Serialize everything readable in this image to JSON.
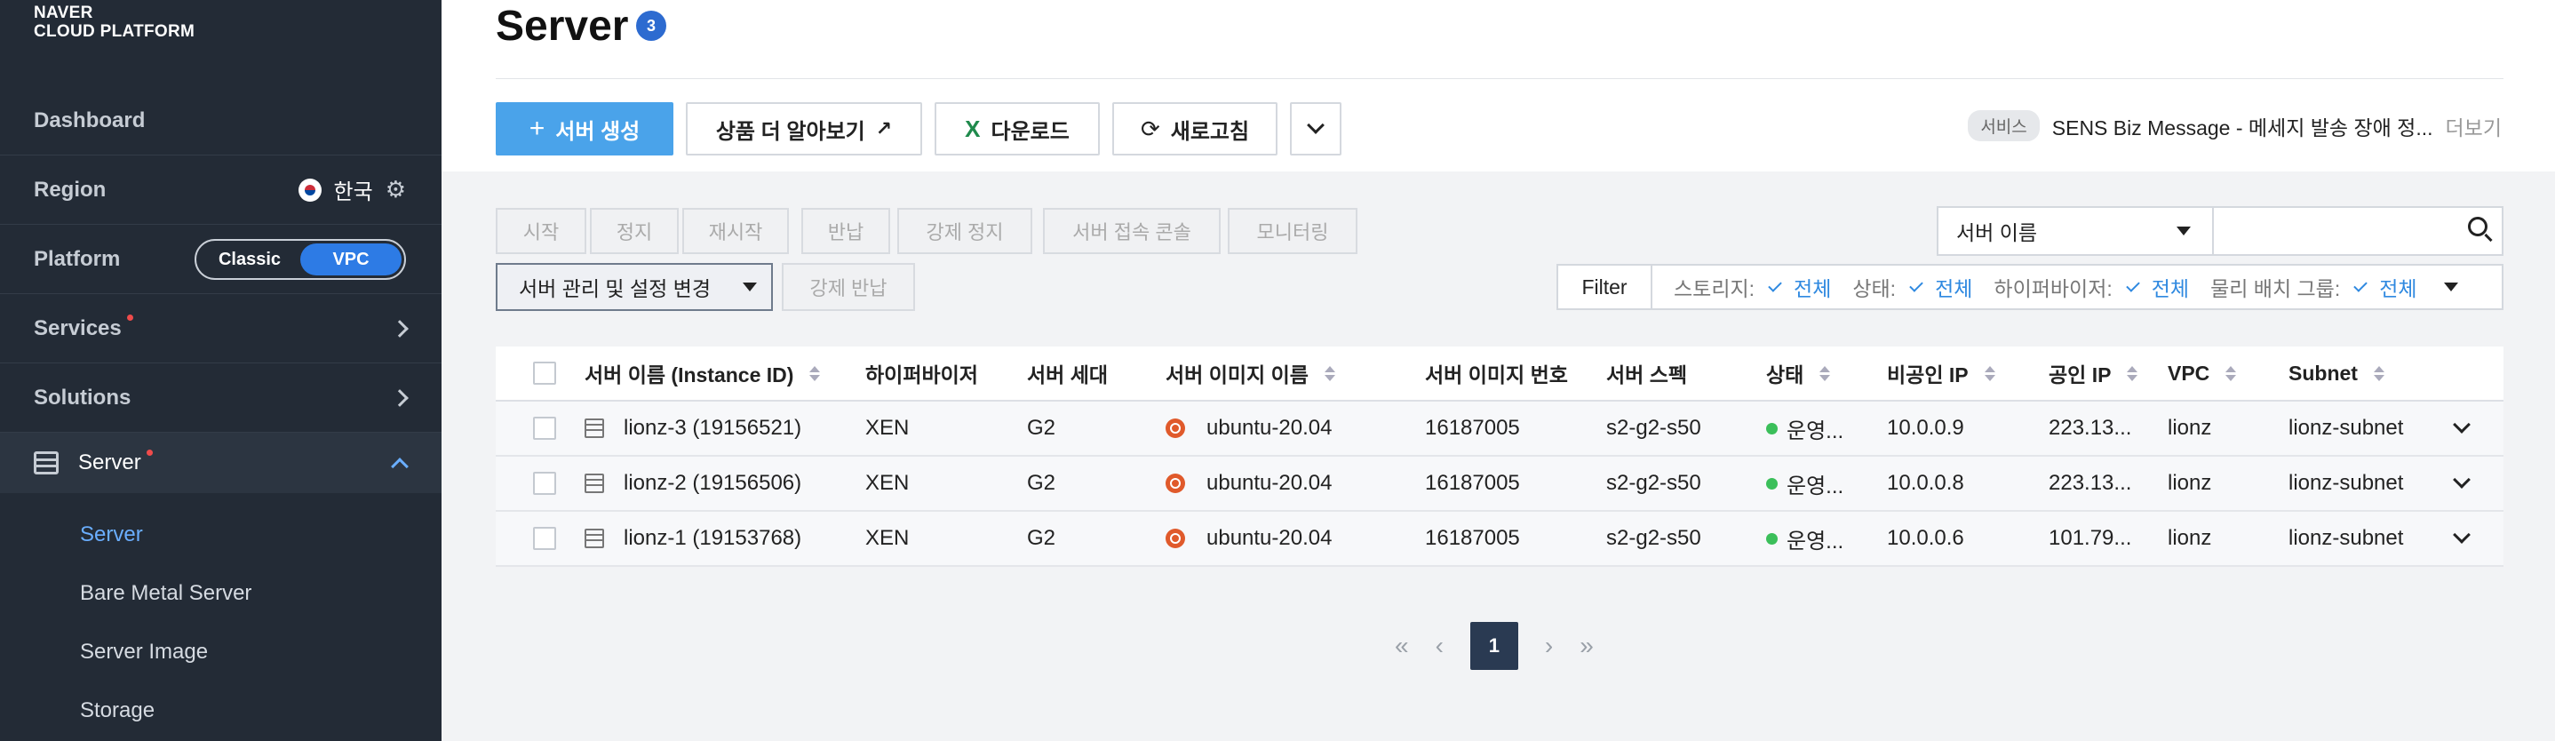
{
  "logo": {
    "line1": "NAVER",
    "line2": "CLOUD PLATFORM"
  },
  "sidebar": {
    "dashboard": "Dashboard",
    "region_label": "Region",
    "region_value": "한국",
    "platform_label": "Platform",
    "platform_options": [
      "Classic",
      "VPC"
    ],
    "platform_selected": "VPC",
    "services": "Services",
    "solutions": "Solutions",
    "server": "Server",
    "sub_items": [
      "Server",
      "Bare Metal Server",
      "Server Image",
      "Storage"
    ],
    "active_sub": "Server"
  },
  "header": {
    "title": "Server",
    "count": "3"
  },
  "toolbar": {
    "create": "서버 생성",
    "learn_more": "상품 더 알아보기",
    "download": "다운로드",
    "refresh": "새로고침"
  },
  "notice": {
    "tag": "서비스",
    "text": "SENS Biz Message - 메세지 발송 장애 정...",
    "more": "더보기"
  },
  "actions": [
    "시작",
    "정지",
    "재시작",
    "반납",
    "강제 정지",
    "서버 접속 콘솔",
    "모니터링"
  ],
  "manage": {
    "label": "서버 관리 및 설정 변경",
    "force_return": "강제 반납"
  },
  "search": {
    "field": "서버 이름",
    "value": ""
  },
  "filter": {
    "label": "Filter",
    "items": [
      {
        "name": "스토리지:",
        "value": "전체"
      },
      {
        "name": "상태:",
        "value": "전체"
      },
      {
        "name": "하이퍼바이저:",
        "value": "전체"
      },
      {
        "name": "물리 배치 그룹:",
        "value": "전체"
      }
    ]
  },
  "table": {
    "columns": [
      "서버 이름 (Instance ID)",
      "하이퍼바이저",
      "서버 세대",
      "서버 이미지 이름",
      "서버 이미지 번호",
      "서버 스펙",
      "상태",
      "비공인 IP",
      "공인 IP",
      "VPC",
      "Subnet"
    ],
    "rows": [
      {
        "name": "lionz-3 (19156521)",
        "hypervisor": "XEN",
        "gen": "G2",
        "image": "ubuntu-20.04",
        "image_no": "16187005",
        "spec": "s2-g2-s50",
        "status": "운영...",
        "private_ip": "10.0.0.9",
        "public_ip": "223.13...",
        "vpc": "lionz",
        "subnet": "lionz-subnet"
      },
      {
        "name": "lionz-2 (19156506)",
        "hypervisor": "XEN",
        "gen": "G2",
        "image": "ubuntu-20.04",
        "image_no": "16187005",
        "spec": "s2-g2-s50",
        "status": "운영...",
        "private_ip": "10.0.0.8",
        "public_ip": "223.13...",
        "vpc": "lionz",
        "subnet": "lionz-subnet"
      },
      {
        "name": "lionz-1 (19153768)",
        "hypervisor": "XEN",
        "gen": "G2",
        "image": "ubuntu-20.04",
        "image_no": "16187005",
        "spec": "s2-g2-s50",
        "status": "운영...",
        "private_ip": "10.0.0.6",
        "public_ip": "101.79...",
        "vpc": "lionz",
        "subnet": "lionz-subnet"
      }
    ]
  },
  "pagination": {
    "current": "1"
  }
}
